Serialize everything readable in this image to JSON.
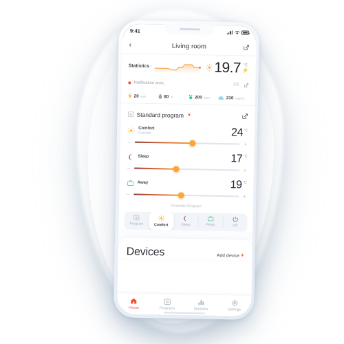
{
  "status_bar": {
    "time": "9:41",
    "signal_icon": "cellular-bars-icon",
    "wifi_icon": "wifi-icon",
    "battery_icon": "battery-full-icon"
  },
  "header": {
    "back_icon": "chevron-left-icon",
    "title": "Living room",
    "edit_icon": "edit-square-icon"
  },
  "statistics": {
    "link_label": "Statistics",
    "chevron": "›",
    "sparkline_icon": "sparkline-chart",
    "weather_icon": "sun-icon",
    "temperature": "19.7",
    "unit": "°C",
    "bolt_icon": "lightning-bolt-icon",
    "accent": "#f96a3b",
    "notification": {
      "dot_icon": "red-dot-icon",
      "label": "Notification area.",
      "count": "2/2",
      "external_icon": "external-link-icon"
    },
    "metrics": [
      {
        "icon": "lightning-bolt-icon",
        "value": "20",
        "unit": "kwh",
        "color": "#f7b733"
      },
      {
        "icon": "humidity-drop-icon",
        "value": "80",
        "unit": "%",
        "color": "#9aa4ae"
      },
      {
        "icon": "co2-icon",
        "value": "200",
        "unit": "ppm",
        "color": "#2ecb82"
      },
      {
        "icon": "cloud-icon",
        "value": "210",
        "unit": "mg/m3",
        "color": "#9fd4f0"
      }
    ]
  },
  "program": {
    "icon": "program-calendar-icon",
    "name": "Standard program",
    "chevron_icon": "chevron-down-icon",
    "edit_icon": "edit-square-icon",
    "override_label": "Override Program",
    "rows": [
      {
        "icon": "sun-icon",
        "title": "Comfort",
        "subtitle": "Current",
        "temp": "24",
        "unit": "°C",
        "percent": 55,
        "minus": "−",
        "plus": "+"
      },
      {
        "icon": "moon-icon",
        "title": "Sleep",
        "subtitle": "",
        "temp": "17",
        "unit": "°C",
        "percent": 40,
        "minus": "−",
        "plus": "+"
      },
      {
        "icon": "briefcase-icon",
        "title": "Away",
        "subtitle": "",
        "temp": "19",
        "unit": "°C",
        "percent": 45,
        "minus": "−",
        "plus": "+"
      }
    ]
  },
  "modes": [
    {
      "icon": "program-calendar-icon",
      "label": "Program",
      "active": false
    },
    {
      "icon": "sun-icon",
      "label": "Comfort",
      "active": true
    },
    {
      "icon": "moon-icon",
      "label": "Sleep",
      "active": false
    },
    {
      "icon": "briefcase-icon",
      "label": "Away",
      "active": false
    },
    {
      "icon": "power-icon",
      "label": "Off",
      "active": false
    }
  ],
  "devices": {
    "title": "Devices",
    "add_label": "Add device",
    "add_plus": "+"
  },
  "tabbar": [
    {
      "icon": "house-icon",
      "label": "House",
      "active": true
    },
    {
      "icon": "program-calendar-icon",
      "label": "Programs",
      "active": false
    },
    {
      "icon": "bar-chart-icon",
      "label": "Statistics",
      "active": false
    },
    {
      "icon": "gear-icon",
      "label": "Settings",
      "active": false
    }
  ]
}
